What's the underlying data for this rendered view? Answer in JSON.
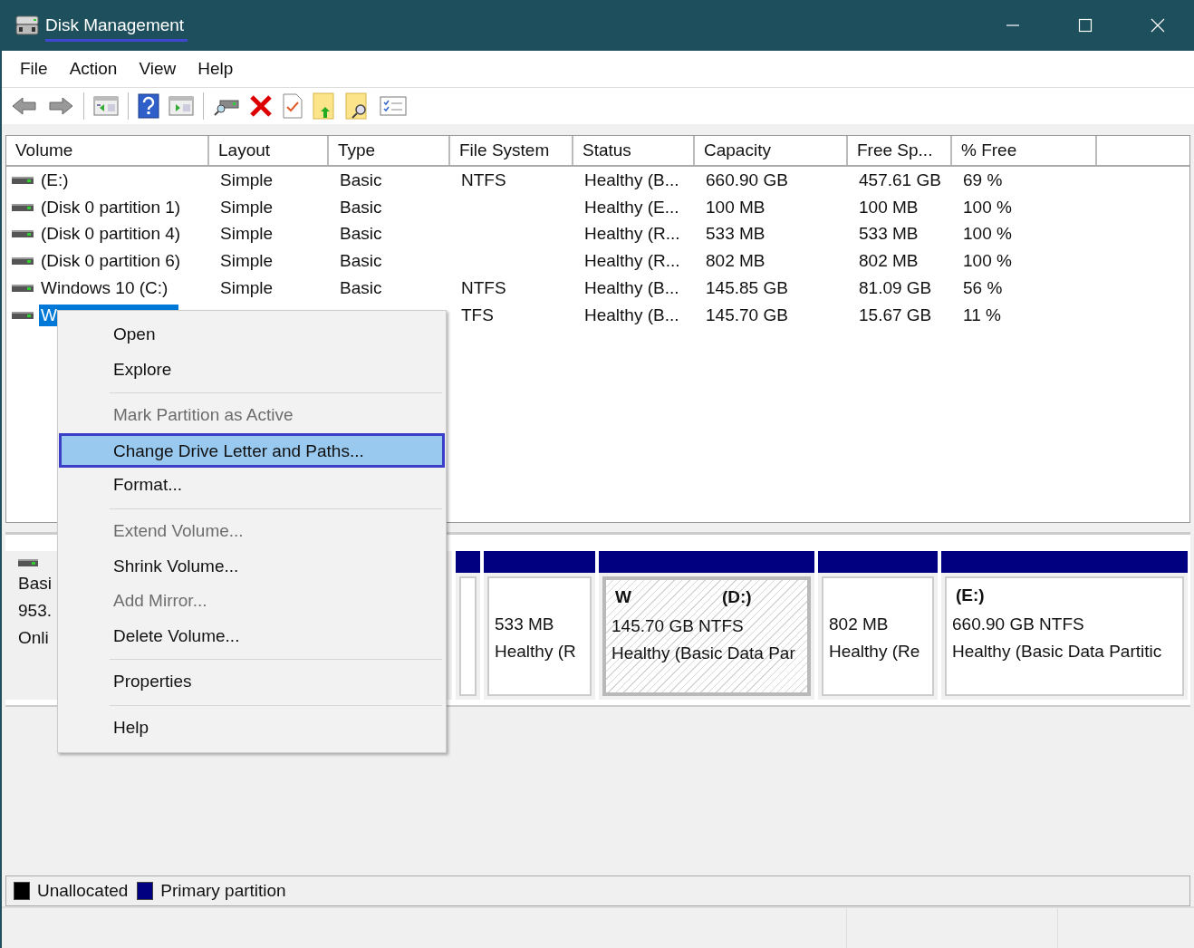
{
  "window": {
    "title": "Disk Management"
  },
  "menu_bar": [
    "File",
    "Action",
    "View",
    "Help"
  ],
  "volume_list": {
    "columns": [
      "Volume",
      "Layout",
      "Type",
      "File System",
      "Status",
      "Capacity",
      "Free Sp...",
      "% Free"
    ],
    "rows": [
      {
        "selected": false,
        "cells": [
          "(E:)",
          "Simple",
          "Basic",
          "NTFS",
          "Healthy (B...",
          "660.90 GB",
          "457.61 GB",
          "69 %"
        ]
      },
      {
        "selected": false,
        "cells": [
          "(Disk 0 partition 1)",
          "Simple",
          "Basic",
          "",
          "Healthy (E...",
          "100 MB",
          "100 MB",
          "100 %"
        ]
      },
      {
        "selected": false,
        "cells": [
          "(Disk 0 partition 4)",
          "Simple",
          "Basic",
          "",
          "Healthy (R...",
          "533 MB",
          "533 MB",
          "100 %"
        ]
      },
      {
        "selected": false,
        "cells": [
          "(Disk 0 partition 6)",
          "Simple",
          "Basic",
          "",
          "Healthy (R...",
          "802 MB",
          "802 MB",
          "100 %"
        ]
      },
      {
        "selected": false,
        "cells": [
          "Windows 10 (C:)",
          "Simple",
          "Basic",
          "NTFS",
          "Healthy (B...",
          "145.85 GB",
          "81.09 GB",
          "56 %"
        ]
      },
      {
        "selected": true,
        "cells": [
          "W",
          "",
          "",
          "TFS",
          "Healthy (B...",
          "145.70 GB",
          "15.67 GB",
          "11 %"
        ]
      }
    ]
  },
  "disk": {
    "label_lines": [
      "Basi",
      "953.",
      "Onli"
    ],
    "partitions": [
      {
        "kind": "partial",
        "selected": false
      },
      {
        "kind": "volume",
        "selected": false,
        "size": "533 MB",
        "status": "Healthy (R"
      },
      {
        "kind": "volume",
        "selected": true,
        "label": "W",
        "letter": "(D:)",
        "size": "145.70 GB NTFS",
        "status": "Healthy (Basic Data Par"
      },
      {
        "kind": "volume",
        "selected": false,
        "size": "802 MB",
        "status": "Healthy (Re"
      },
      {
        "kind": "volume",
        "selected": false,
        "letter": "(E:)",
        "size": "660.90 GB NTFS",
        "status": "Healthy (Basic Data Partitic"
      }
    ]
  },
  "legend": [
    {
      "label": "Unallocated",
      "color": "#000000"
    },
    {
      "label": "Primary partition",
      "color": "#000080"
    }
  ],
  "context_menu": [
    {
      "kind": "item",
      "label": "Open",
      "disabled": false,
      "selected": false
    },
    {
      "kind": "item",
      "label": "Explore",
      "disabled": false,
      "selected": false
    },
    {
      "kind": "separator"
    },
    {
      "kind": "item",
      "label": "Mark Partition as Active",
      "disabled": true,
      "selected": false
    },
    {
      "kind": "item",
      "label": "Change Drive Letter and Paths...",
      "disabled": false,
      "selected": true
    },
    {
      "kind": "item",
      "label": "Format...",
      "disabled": false,
      "selected": false
    },
    {
      "kind": "separator"
    },
    {
      "kind": "item",
      "label": "Extend Volume...",
      "disabled": true,
      "selected": false
    },
    {
      "kind": "item",
      "label": "Shrink Volume...",
      "disabled": false,
      "selected": false
    },
    {
      "kind": "item",
      "label": "Add Mirror...",
      "disabled": true,
      "selected": false
    },
    {
      "kind": "item",
      "label": "Delete Volume...",
      "disabled": false,
      "selected": false
    },
    {
      "kind": "separator"
    },
    {
      "kind": "item",
      "label": "Properties",
      "disabled": false,
      "selected": false
    },
    {
      "kind": "separator"
    },
    {
      "kind": "item",
      "label": "Help",
      "disabled": false,
      "selected": false
    }
  ]
}
